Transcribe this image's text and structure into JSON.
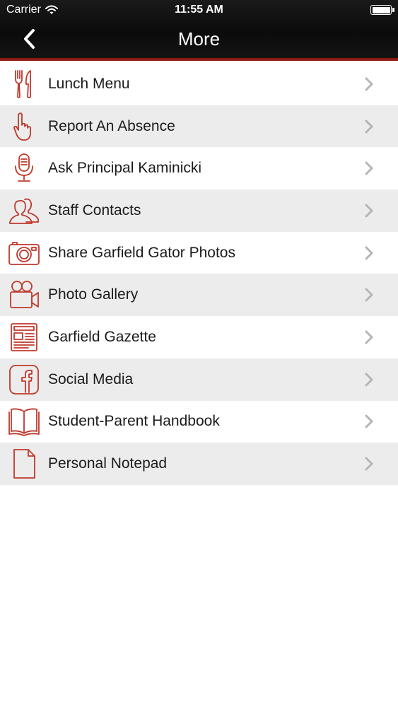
{
  "status_bar": {
    "carrier": "Carrier",
    "time": "11:55 AM"
  },
  "nav": {
    "title": "More"
  },
  "colors": {
    "accent": "#c0392b",
    "nav_background": "#111111",
    "nav_border": "#8b1a12",
    "row_alt": "#ececec",
    "chevron": "#b5b5b5"
  },
  "menu": {
    "items": [
      {
        "label": "Lunch Menu",
        "icon": "fork-knife-icon"
      },
      {
        "label": "Report An Absence",
        "icon": "pointing-hand-icon"
      },
      {
        "label": "Ask Principal Kaminicki",
        "icon": "microphone-icon"
      },
      {
        "label": "Staff Contacts",
        "icon": "people-icon"
      },
      {
        "label": "Share Garfield Gator Photos",
        "icon": "camera-icon"
      },
      {
        "label": "Photo Gallery",
        "icon": "video-camera-icon"
      },
      {
        "label": "Garfield Gazette",
        "icon": "newspaper-icon"
      },
      {
        "label": "Social Media",
        "icon": "facebook-icon"
      },
      {
        "label": "Student-Parent Handbook",
        "icon": "open-book-icon"
      },
      {
        "label": "Personal Notepad",
        "icon": "document-icon"
      }
    ]
  }
}
